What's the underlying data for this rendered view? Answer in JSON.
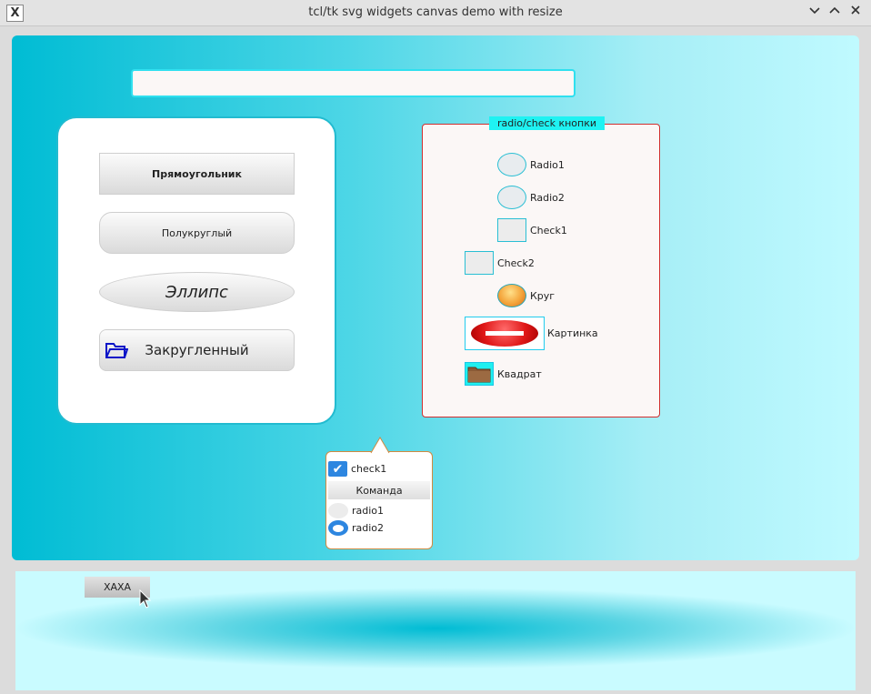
{
  "window": {
    "title": "tcl/tk svg widgets canvas demo with resize",
    "app_icon": "x-window-icon",
    "buttons": [
      "minimize-icon",
      "maximize-icon",
      "close-icon"
    ]
  },
  "top_entry": {
    "value": ""
  },
  "left_panel": {
    "buttons": [
      {
        "label": "Прямоугольник"
      },
      {
        "label": "Полукруглый"
      },
      {
        "label": "Эллипс"
      },
      {
        "label": "Закругленный",
        "icon": "folder-icon"
      }
    ]
  },
  "right_panel": {
    "legend": "radio/check кнопки",
    "items": [
      {
        "label": "Radio1"
      },
      {
        "label": "Radio2"
      },
      {
        "label": "Check1"
      },
      {
        "label": "Check2"
      },
      {
        "label": "Круг"
      },
      {
        "label": "Картинка"
      },
      {
        "label": "Квадрат"
      }
    ]
  },
  "popup": {
    "check1": {
      "label": "check1",
      "checked": true
    },
    "command": {
      "label": "Команда"
    },
    "radio1": {
      "label": "radio1",
      "selected": false
    },
    "radio2": {
      "label": "radio2",
      "selected": true
    }
  },
  "bottom_canvas": {
    "button": {
      "label": "XAXA"
    }
  },
  "colors": {
    "accent": "#00bcd4",
    "panel_border": "#d03030",
    "legend_bg": "#1ff2f2",
    "check_blue": "#2d86e0"
  }
}
